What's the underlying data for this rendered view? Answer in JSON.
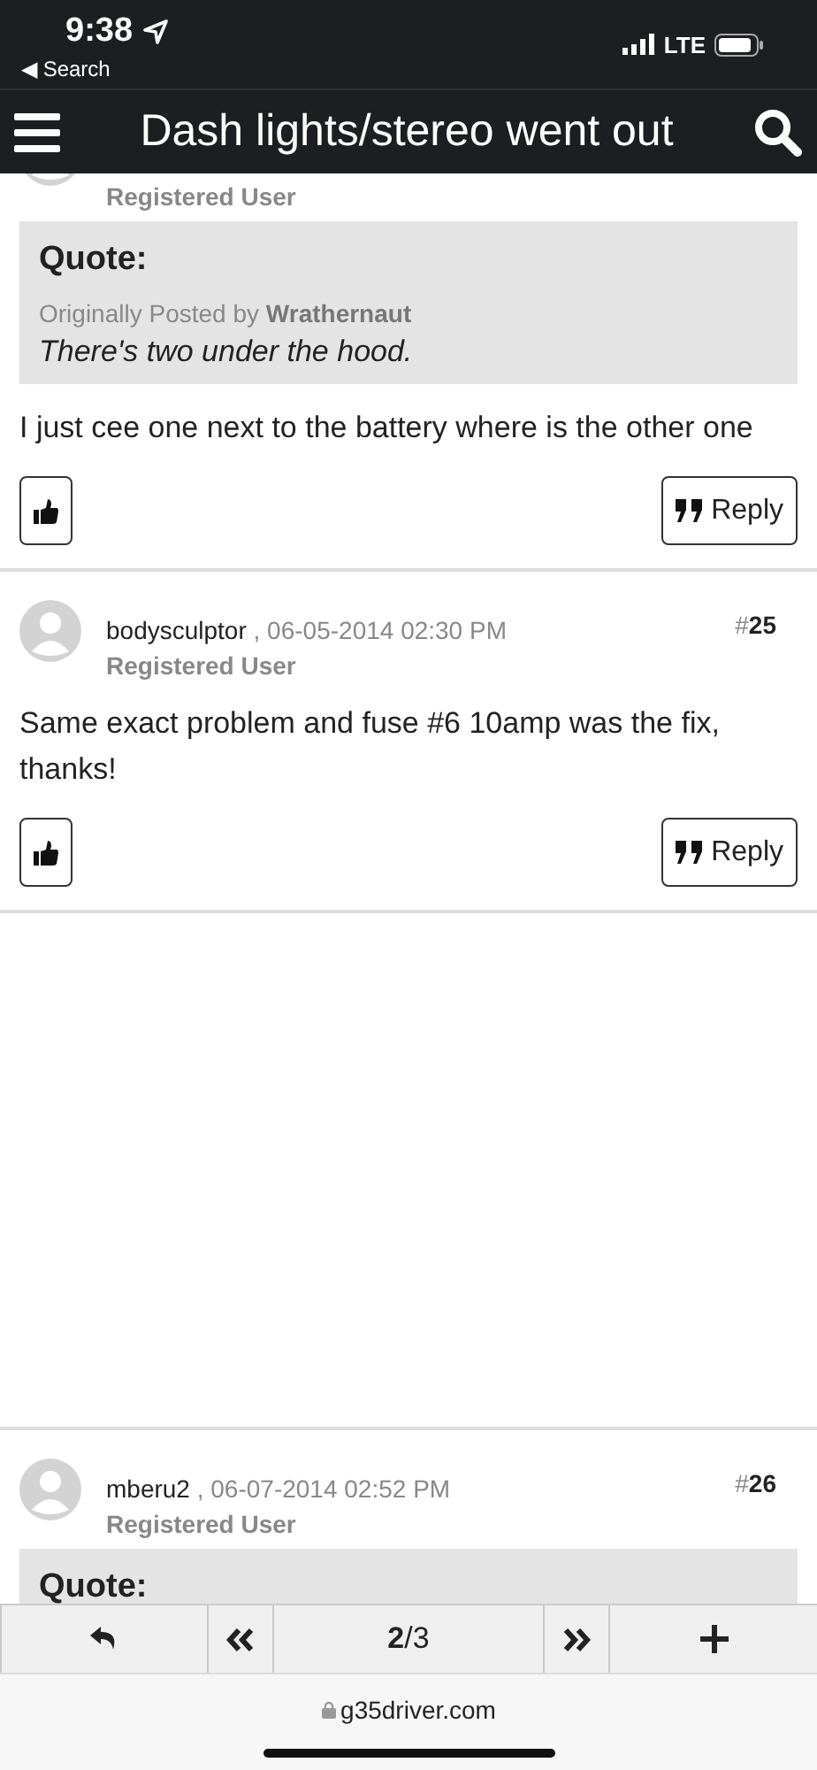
{
  "status_bar": {
    "time": "9:38",
    "back_label": "◀ Search",
    "network": "LTE"
  },
  "nav_bar": {
    "title": "Dash lights/stereo went out"
  },
  "posts": [
    {
      "kind": "partial",
      "role": "Registered User",
      "quote": {
        "heading": "Quote:",
        "prefix": "Originally Posted by",
        "name": "Wrathernaut",
        "text": "There's two under the hood."
      },
      "body": "I just cee one next to the battery where is the other one",
      "reply": "Reply"
    },
    {
      "kind": "full",
      "author": "bodysculptor",
      "date": ", 06-05-2014 02:30 PM",
      "number_prefix": "#",
      "number": "25",
      "role": "Registered User",
      "body": "Same exact problem and fuse #6 10amp was the fix, thanks!",
      "reply": "Reply"
    },
    {
      "kind": "spacer"
    },
    {
      "kind": "full",
      "author": "mberu2",
      "date": ", 06-07-2014 02:52 PM",
      "number_prefix": "#",
      "number": "26",
      "role": "Registered User",
      "quote": {
        "heading": "Quote:"
      }
    }
  ],
  "toolbar": {
    "page": "**2**/3"
  },
  "address_bar": {
    "domain": "g35driver.com"
  }
}
